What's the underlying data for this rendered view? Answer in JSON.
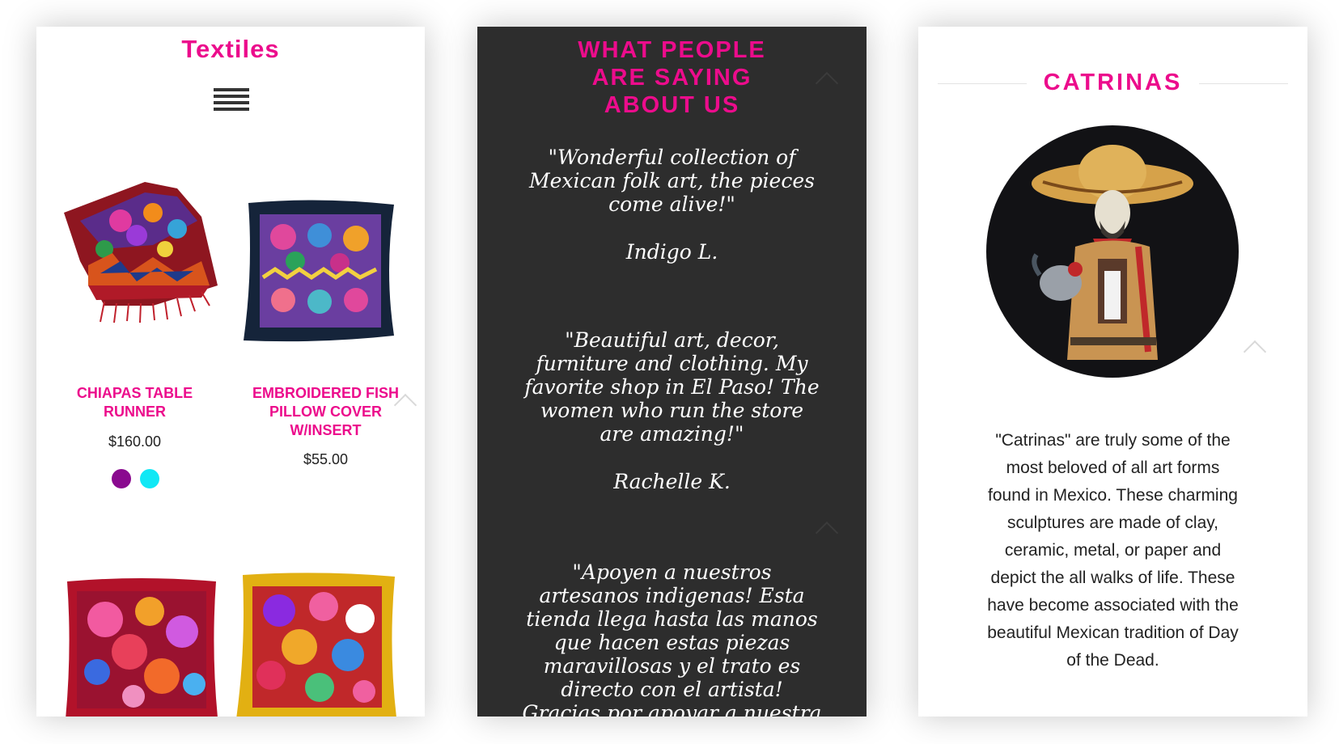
{
  "textiles_panel": {
    "title": "Textiles",
    "menu_icon": "hamburger-menu-icon",
    "products": [
      {
        "name": "CHIAPAS TABLE RUNNER",
        "price": "$160.00",
        "swatches": [
          "#8a0a8f",
          "#11e8f5"
        ]
      },
      {
        "name": "EMBROIDERED FISH PILLOW COVER W/INSERT",
        "price": "$55.00",
        "swatches": []
      }
    ],
    "second_row": [
      "red-embroidered-pillow",
      "yellow-embroidered-pillow"
    ]
  },
  "testimonials_panel": {
    "title": "WHAT PEOPLE ARE SAYING ABOUT US",
    "testimonials": [
      {
        "quote": "\"Wonderful collection of Mexican folk art, the pieces come alive!\"",
        "author": "Indigo L."
      },
      {
        "quote": "\"Beautiful art, decor, furniture and clothing. My favorite shop in El Paso! The women who run the store are amazing!\"",
        "author": "Rachelle K."
      },
      {
        "quote": "\"Apoyen a nuestros artesanos indigenas! Esta tienda llega hasta las manos que hacen estas piezas maravillosas y el trato es directo con el artista! Gracias por apoyar a nuestra gente!\"",
        "author": ""
      }
    ]
  },
  "catrinas_panel": {
    "title": "CATRINAS",
    "description": "\"Catrinas\" are truly some of the most beloved of all art forms found in Mexico. These charming sculptures are made of clay, ceramic, metal, or paper and depict the all walks of life. These have become associated with the beautiful Mexican tradition of Day of the Dead."
  },
  "colors": {
    "accent": "#ec0c8c",
    "dark_panel": "#2d2d2d",
    "text": "#222222"
  }
}
